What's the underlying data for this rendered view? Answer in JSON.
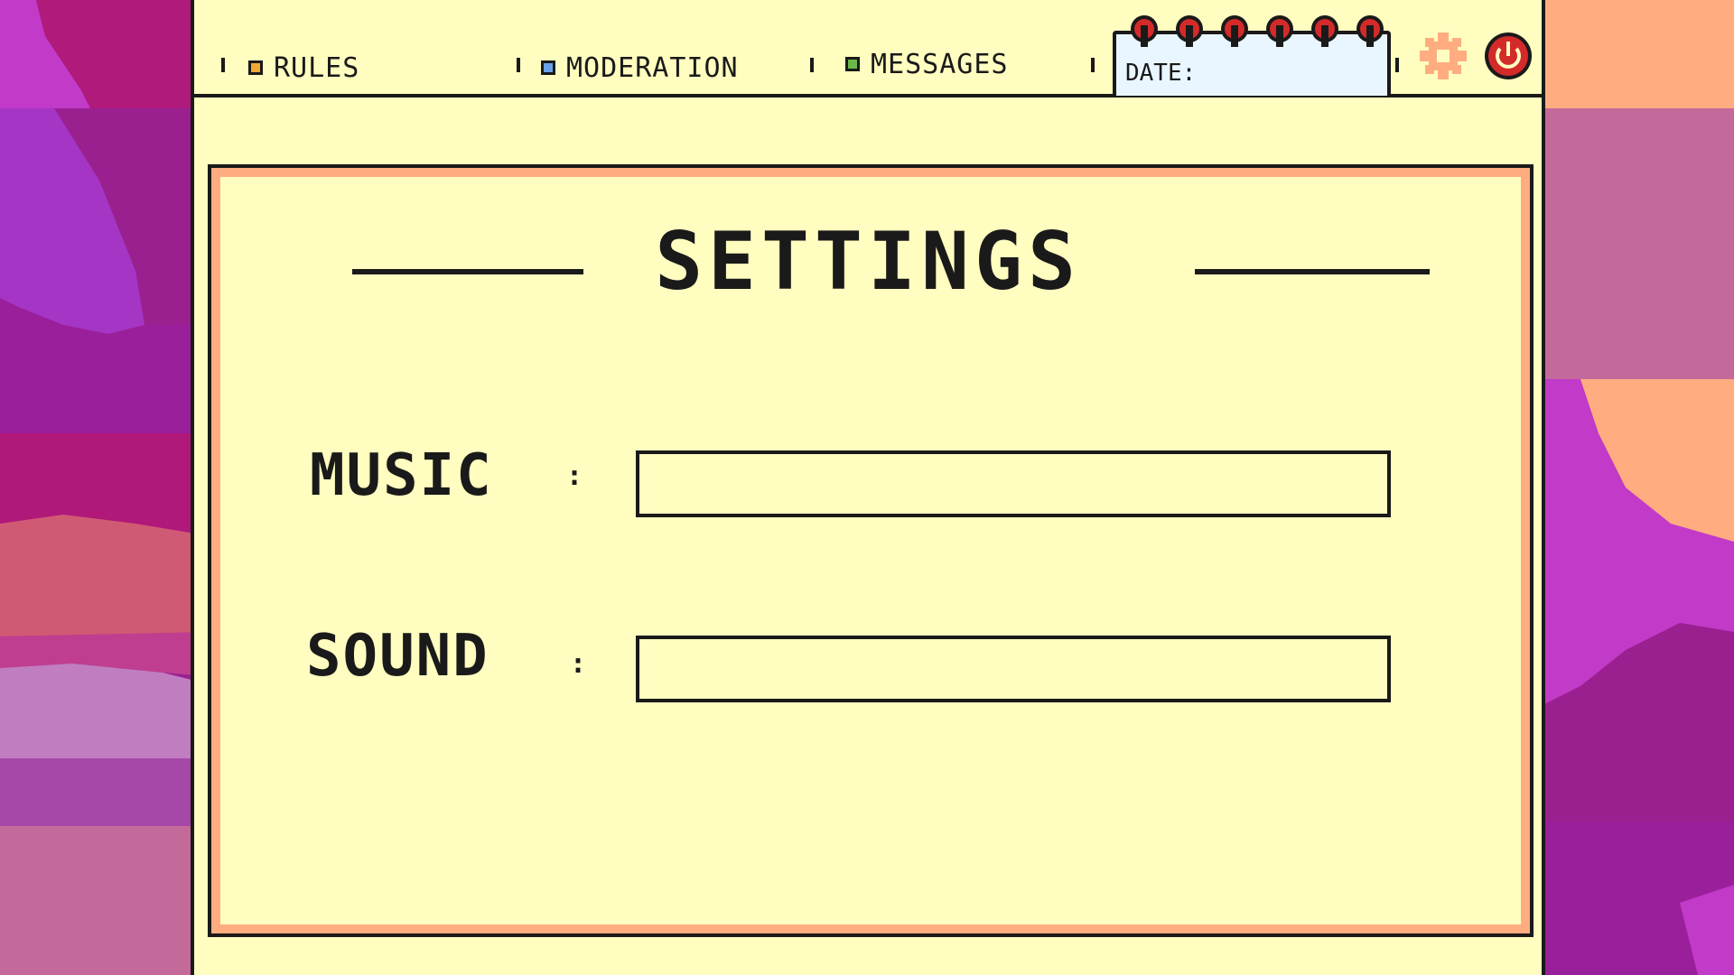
{
  "tabs": [
    {
      "label": "RULES",
      "color": "#f0a830"
    },
    {
      "label": "MODERATION",
      "color": "#6aa0e8"
    },
    {
      "label": "MESSAGES",
      "color": "#6ab84a"
    }
  ],
  "date_label": "DATE:",
  "icons": {
    "settings": "gear-icon",
    "power": "power-icon",
    "rings": "notepad-rings-icon"
  },
  "settings": {
    "title": "SETTINGS",
    "rows": [
      {
        "label": "MUSIC",
        "separator": ":",
        "level": 0
      },
      {
        "label": "SOUND",
        "separator": ":",
        "level": 0
      }
    ]
  },
  "colors": {
    "panel_bg": "#fffdbf",
    "accent": "#ffad80",
    "outline": "#1a1a1a",
    "power_red": "#d42a2a",
    "gear_orange": "#ffad80"
  }
}
